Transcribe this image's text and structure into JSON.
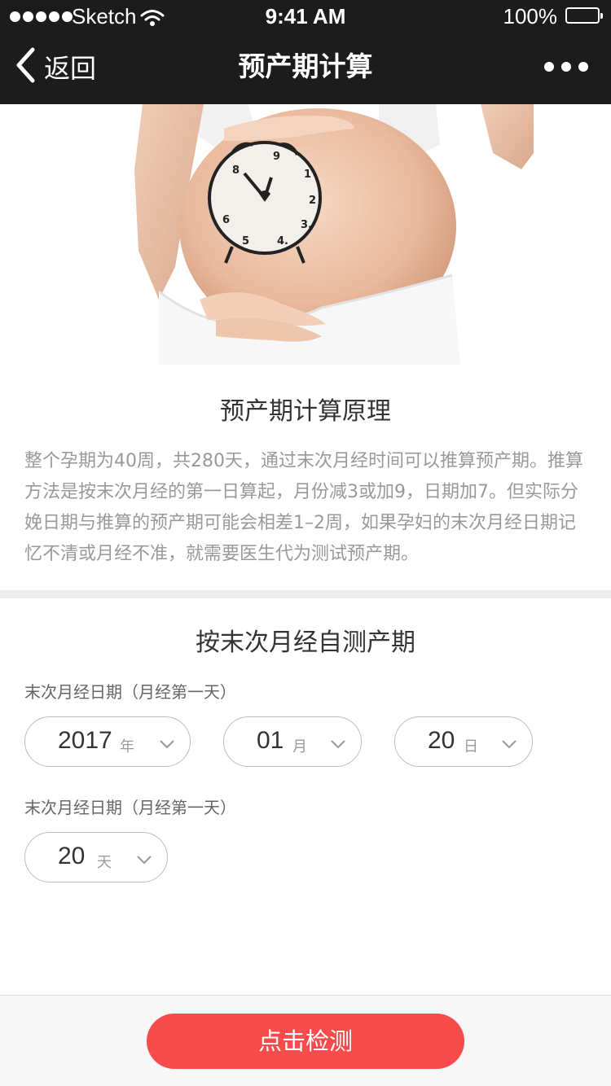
{
  "status_bar": {
    "carrier": "Sketch",
    "time": "9:41 AM",
    "battery": "100%"
  },
  "nav": {
    "back_label": "返回",
    "title": "预产期计算"
  },
  "principle": {
    "title": "预产期计算原理",
    "text": "整个孕期为40周，共280天，通过末次月经时间可以推算预产期。推算方法是按末次月经的第一日算起，月份减3或加9，日期加7。但实际分娩日期与推算的预产期可能会相差1–2周，如果孕妇的末次月经日期记忆不清或月经不准，就需要医生代为测试预产期。"
  },
  "calculator": {
    "title": "按末次月经自测产期",
    "date_label": "末次月经日期（月经第一天）",
    "year": {
      "value": "2017",
      "unit": "年"
    },
    "month": {
      "value": "01",
      "unit": "月"
    },
    "day": {
      "value": "20",
      "unit": "日"
    },
    "cycle_label": "末次月经日期（月经第一天）",
    "cycle": {
      "value": "20",
      "unit": "天"
    }
  },
  "action": {
    "detect_label": "点击检测"
  },
  "colors": {
    "nav_bg": "#1c1c1c",
    "accent": "#f84b4b",
    "muted_text": "#999999"
  },
  "icons": [
    "back-chevron-icon",
    "wifi-icon",
    "battery-icon",
    "more-icon",
    "chevron-down-icon"
  ]
}
